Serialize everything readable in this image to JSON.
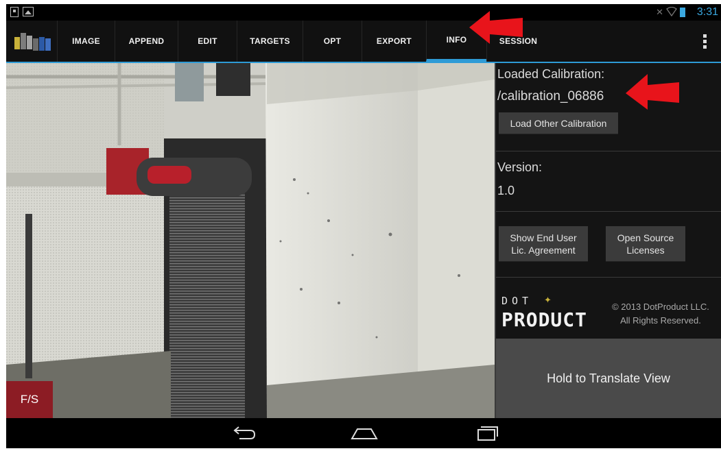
{
  "status_bar": {
    "time": "3:31"
  },
  "tabs": [
    {
      "label": "IMAGE"
    },
    {
      "label": "APPEND"
    },
    {
      "label": "EDIT"
    },
    {
      "label": "TARGETS"
    },
    {
      "label": "OPT"
    },
    {
      "label": "EXPORT"
    },
    {
      "label": "INFO"
    },
    {
      "label": "SESSION"
    }
  ],
  "selected_tab": "INFO",
  "viewport": {
    "fs_label": "F/S"
  },
  "info": {
    "calibration_label": "Loaded Calibration:",
    "calibration_value": "/calibration_06886",
    "load_other_label": "Load Other Calibration",
    "version_label": "Version:",
    "version_value": "1.0",
    "eula_line1": "Show End User",
    "eula_line2": "Lic. Agreement",
    "oss_line1": "Open Source",
    "oss_line2": "Licenses",
    "brand_top": "DOT",
    "brand_bottom": "PRODUCT",
    "copyright_line1": "© 2013 DotProduct LLC.",
    "copyright_line2": "All Rights Reserved.",
    "translate_label": "Hold to Translate View"
  },
  "colors": {
    "accent": "#2e9bd6",
    "fs_button": "#8c1c24",
    "annotation_arrow": "#e8141b"
  },
  "icons": {
    "status_left": [
      "notification-icon",
      "image-notification-icon"
    ],
    "status_right": [
      "mute-icon",
      "wifi-icon",
      "battery-icon"
    ],
    "nav": [
      "back-icon",
      "home-icon",
      "recent-apps-icon"
    ],
    "overflow": "overflow-menu-icon"
  }
}
